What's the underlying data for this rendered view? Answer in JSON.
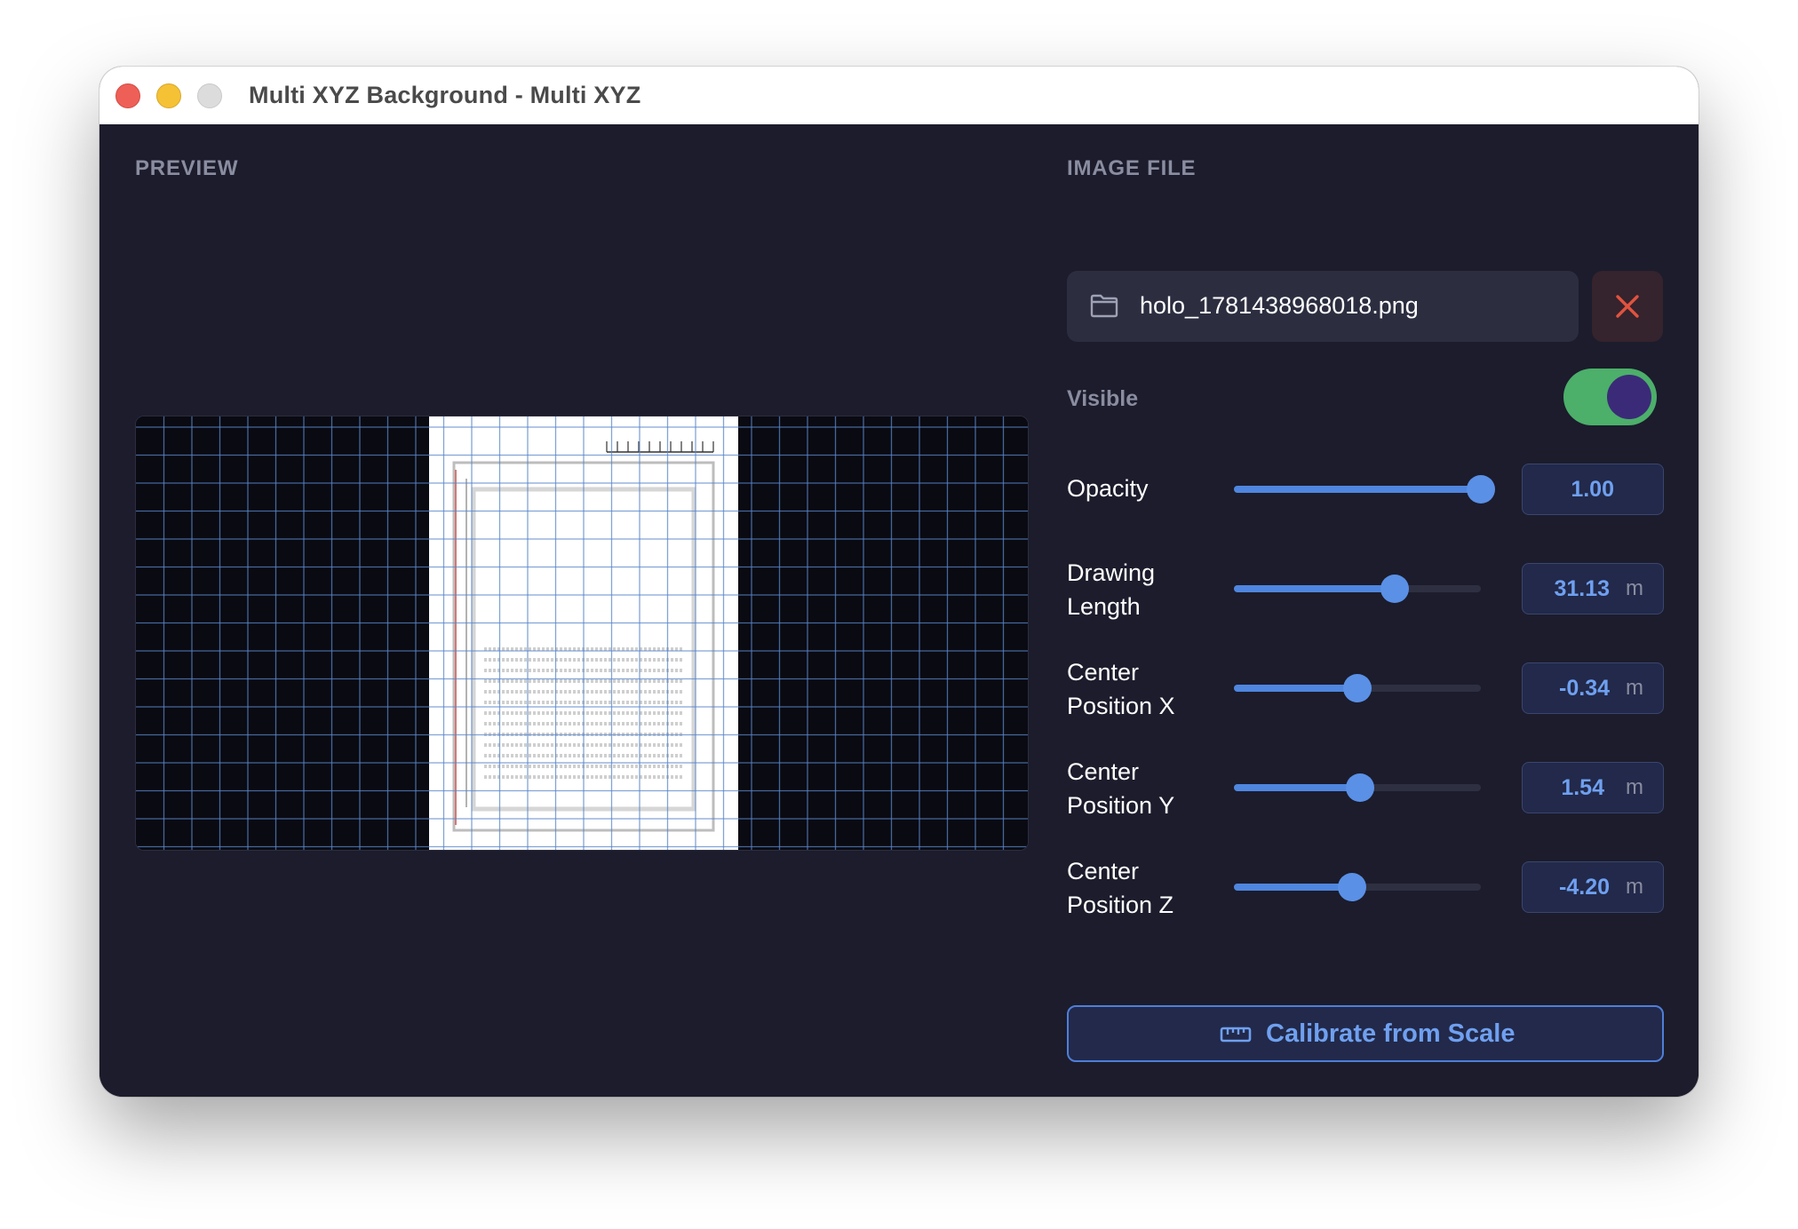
{
  "window": {
    "title": "Multi XYZ Background - Multi XYZ"
  },
  "preview": {
    "label": "PREVIEW"
  },
  "image_file": {
    "label": "IMAGE FILE",
    "file_name": "holo_1781438968018.png"
  },
  "visible": {
    "label": "Visible",
    "on": true
  },
  "params": {
    "opacity": {
      "label": "Opacity",
      "value": "1.00",
      "unit": "",
      "slider_fraction": 1.0
    },
    "drawing_length": {
      "label_line1": "Drawing",
      "label_line2": "Length",
      "value": "31.13",
      "unit": "m",
      "slider_fraction": 0.65
    },
    "center_x": {
      "label_line1": "Center",
      "label_line2": "Position X",
      "value": "-0.34",
      "unit": "m",
      "slider_fraction": 0.5
    },
    "center_y": {
      "label_line1": "Center",
      "label_line2": "Position Y",
      "value": "1.54",
      "unit": "m",
      "slider_fraction": 0.51
    },
    "center_z": {
      "label_line1": "Center",
      "label_line2": "Position Z",
      "value": "-4.20",
      "unit": "m",
      "slider_fraction": 0.48
    }
  },
  "calibrate": {
    "label": "Calibrate from Scale"
  },
  "colors": {
    "background": "#1c1c2c",
    "accent": "#4f86df",
    "toggle_on": "#4caf6a",
    "remove": "#e0533f"
  }
}
